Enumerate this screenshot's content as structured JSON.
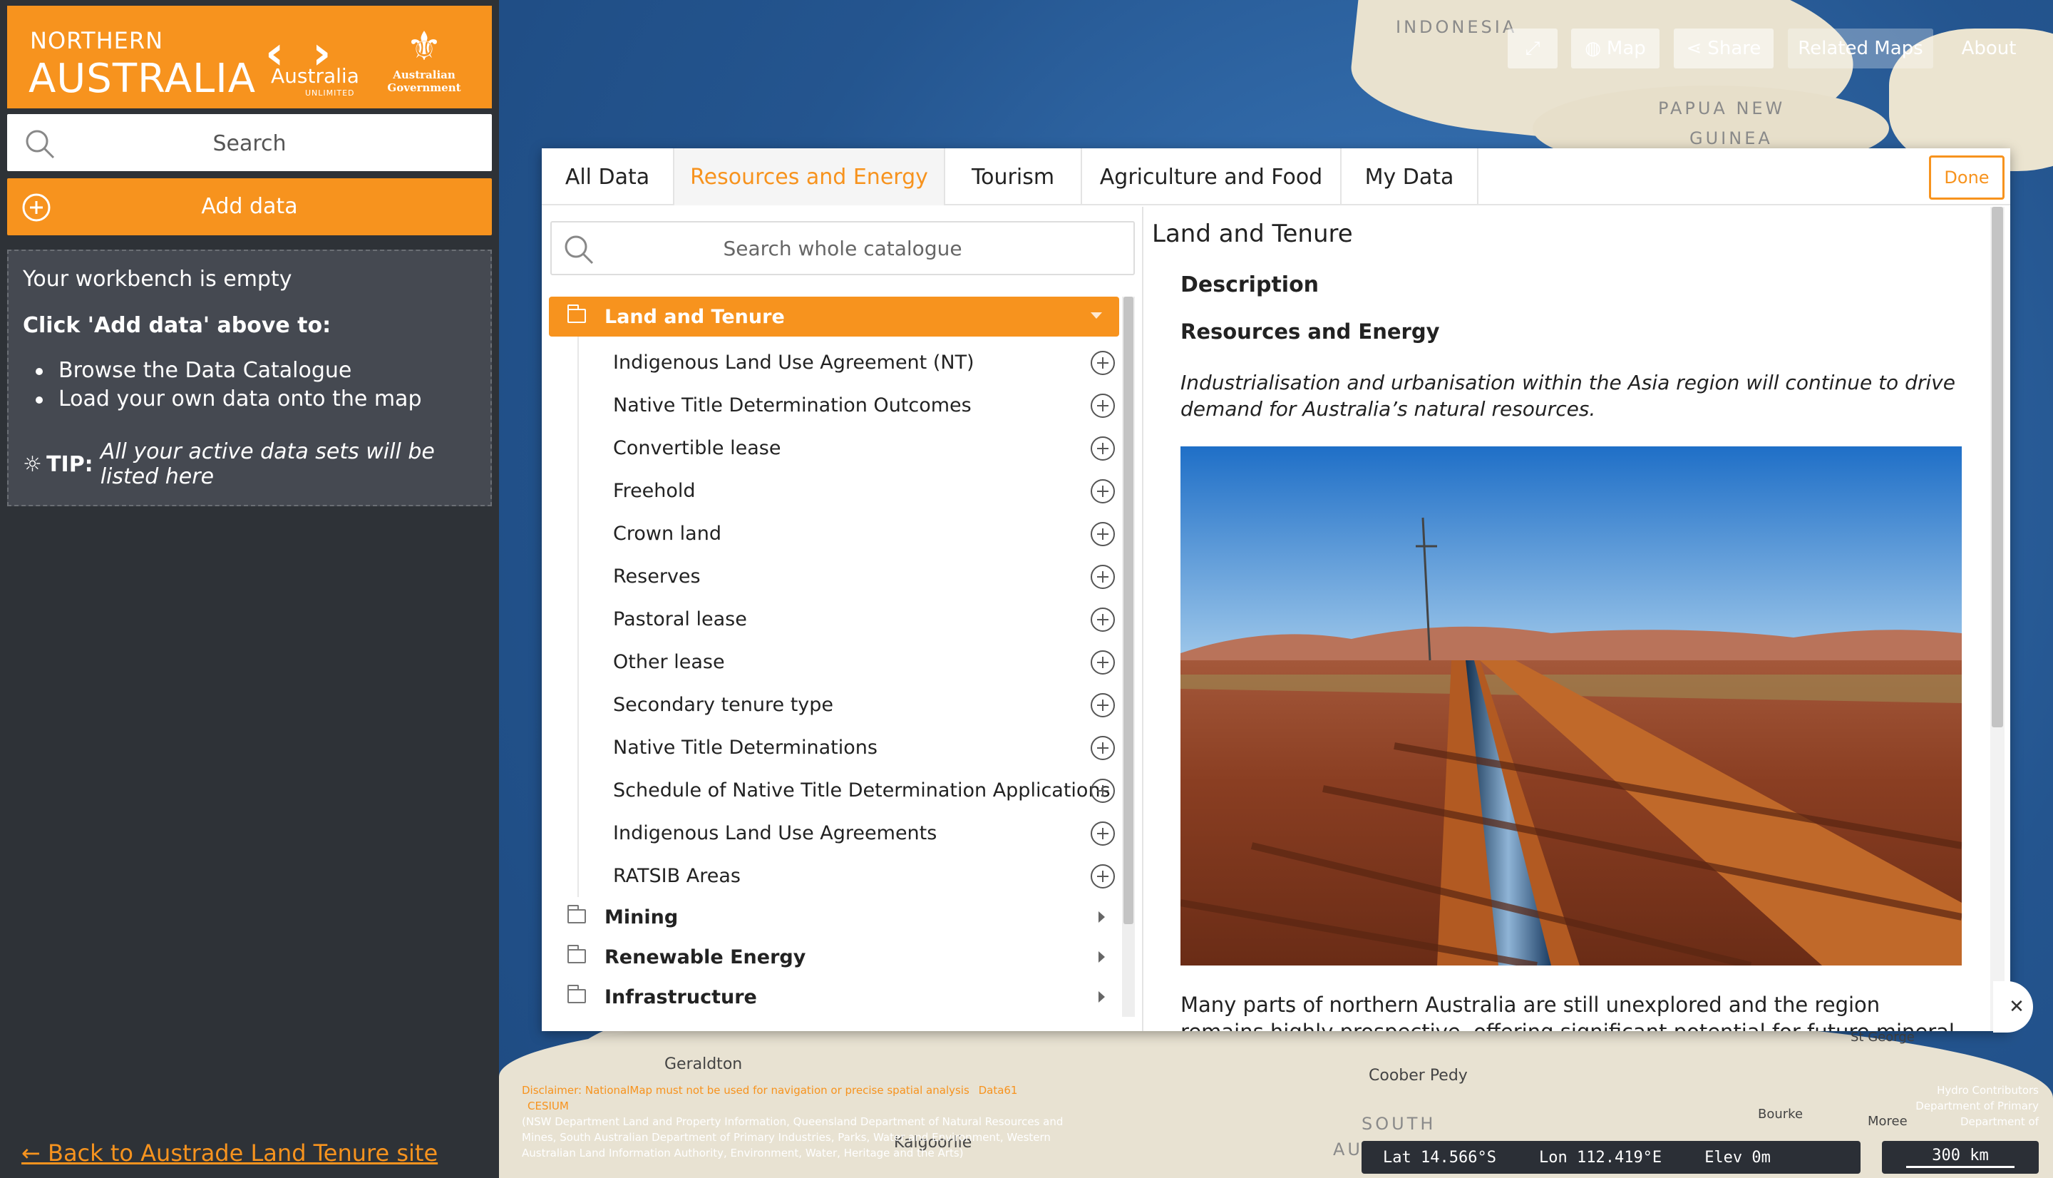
{
  "brand": {
    "line1": "NORTHERN",
    "line2": "AUSTRALIA",
    "partner": "Australia",
    "partner_sub": "UNLIMITED",
    "gov": "Australian Government"
  },
  "sidebar": {
    "search_label": "Search",
    "add_data_label": "Add data",
    "workbench": {
      "empty_title": "Your workbench is empty",
      "instruction": "Click 'Add data' above to:",
      "bullets": [
        "Browse the Data Catalogue",
        "Load your own data onto the map"
      ],
      "tip_label": "TIP:",
      "tip_text": "All your active data sets will be listed here"
    },
    "back_link": "← Back to Austrade Land Tenure site"
  },
  "map": {
    "labels": {
      "indonesia": "INDONESIA",
      "papua": "PAPUA NEW",
      "guinea": "GUINEA",
      "geraldton": "Geraldton",
      "kalgoorlie": "Kalgoorlie",
      "coober_pedy": "Coober Pedy",
      "south": "SOUTH",
      "au": "AU",
      "bourke": "Bourke",
      "st_george": "St George",
      "moree": "Moree"
    },
    "buttons": {
      "map": "Map",
      "share": "Share",
      "related": "Related Maps",
      "about": "About"
    },
    "disclaimer": {
      "text": "Disclaimer: NationalMap must not be used for navigation or precise spatial analysis",
      "link1": "Data61",
      "link2": "CESIUM",
      "attribution": "(NSW Department Land and Property Information, Queensland Department of Natural Resources and Mines, South Australian Department of Primary Industries, Parks, Water and Environment, Western Australian Land Information Authority, Environment, Water, Heritage and the Arts)"
    },
    "credits": "Hydro Contributors Department of Primary Department of",
    "coords": {
      "lat_label": "Lat",
      "lat": "14.566°S",
      "lon_label": "Lon",
      "lon": "112.419°E",
      "elev_label": "Elev",
      "elev": "0m"
    },
    "scale": "300 km"
  },
  "modal": {
    "tabs": [
      "All Data",
      "Resources and Energy",
      "Tourism",
      "Agriculture and Food",
      "My Data"
    ],
    "active_tab": "Resources and Energy",
    "done_label": "Done",
    "catalogue_search_placeholder": "Search whole catalogue",
    "open_group": "Land and Tenure",
    "items": [
      "Indigenous Land Use Agreement (NT)",
      "Native Title Determination Outcomes",
      "Convertible lease",
      "Freehold",
      "Crown land",
      "Reserves",
      "Pastoral lease",
      "Other lease",
      "Secondary tenure type",
      "Native Title Determinations",
      "Schedule of Native Title Determination Applications",
      "Indigenous Land Use Agreements",
      "RATSIB Areas"
    ],
    "closed_groups": [
      "Mining",
      "Renewable Energy",
      "Infrastructure"
    ],
    "detail": {
      "title": "Land and Tenure",
      "description_heading": "Description",
      "subheading": "Resources and Energy",
      "italic": "Industrialisation and urbanisation within the Asia region will continue to drive demand for Australia’s natural resources.",
      "body": "Many parts of northern Australia are still unexplored and the region remains highly prospective, offering significant potential for future mineral discoveries."
    }
  },
  "colors": {
    "accent": "#f7931e",
    "sidebar_bg": "#2e3237",
    "workbench_bg": "#454951"
  }
}
